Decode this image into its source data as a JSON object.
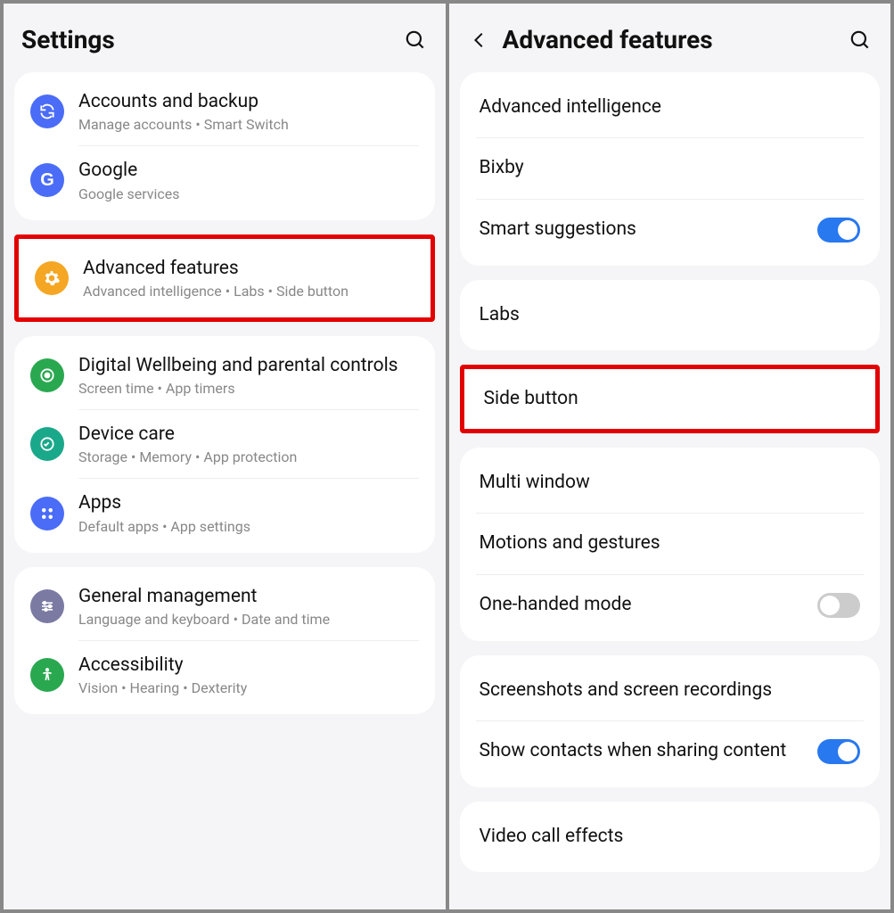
{
  "left": {
    "title": "Settings",
    "groups": [
      {
        "items": [
          {
            "icon": "sync",
            "color": "#4a6cf7",
            "title": "Accounts and backup",
            "sub": "Manage accounts  •  Smart Switch"
          },
          {
            "icon": "G",
            "color": "#4a6cf7",
            "title": "Google",
            "sub": "Google services"
          }
        ]
      },
      {
        "highlight": true,
        "items": [
          {
            "icon": "gear",
            "color": "#f5a623",
            "title": "Advanced features",
            "sub": "Advanced intelligence  •  Labs  •  Side button"
          }
        ]
      },
      {
        "items": [
          {
            "icon": "wellbeing",
            "color": "#2aa850",
            "title": "Digital Wellbeing and parental controls",
            "sub": "Screen time  •  App timers"
          },
          {
            "icon": "devicecare",
            "color": "#1aa88a",
            "title": "Device care",
            "sub": "Storage  •  Memory  •  App protection"
          },
          {
            "icon": "apps",
            "color": "#4a6cf7",
            "title": "Apps",
            "sub": "Default apps  •  App settings"
          }
        ]
      },
      {
        "items": [
          {
            "icon": "sliders",
            "color": "#7a7aa3",
            "title": "General management",
            "sub": "Language and keyboard  •  Date and time"
          },
          {
            "icon": "accessibility",
            "color": "#2aa850",
            "title": "Accessibility",
            "sub": "Vision  •  Hearing  •  Dexterity"
          }
        ]
      }
    ]
  },
  "right": {
    "title": "Advanced features",
    "groups": [
      {
        "items": [
          {
            "title": "Advanced intelligence"
          },
          {
            "title": "Bixby"
          },
          {
            "title": "Smart suggestions",
            "toggle": true
          }
        ]
      },
      {
        "items": [
          {
            "title": "Labs"
          }
        ]
      },
      {
        "highlight": true,
        "items": [
          {
            "title": "Side button"
          }
        ]
      },
      {
        "items": [
          {
            "title": "Multi window"
          },
          {
            "title": "Motions and gestures"
          },
          {
            "title": "One-handed mode",
            "toggle": false
          }
        ]
      },
      {
        "items": [
          {
            "title": "Screenshots and screen recordings"
          },
          {
            "title": "Show contacts when sharing content",
            "toggle": true
          }
        ]
      },
      {
        "items": [
          {
            "title": "Video call effects"
          }
        ]
      }
    ]
  }
}
